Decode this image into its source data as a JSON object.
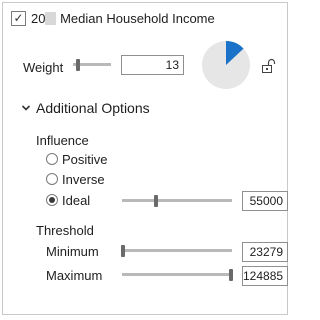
{
  "layer": {
    "checked": true,
    "title_prefix": "20",
    "title_suffix": "Median Household Income"
  },
  "weight": {
    "label": "Weight",
    "value": "13",
    "slider_fraction": 0.13,
    "pie_fraction": 0.13,
    "colors": {
      "pie_slice": "#1a73c8",
      "pie_base": "#e6e6e6"
    }
  },
  "additional_options": {
    "label": "Additional Options",
    "influence": {
      "label": "Influence",
      "options": [
        {
          "label": "Positive",
          "selected": false
        },
        {
          "label": "Inverse",
          "selected": false
        },
        {
          "label": "Ideal",
          "selected": true
        }
      ],
      "ideal_value": "55000",
      "ideal_slider_fraction": 0.31
    },
    "threshold": {
      "label": "Threshold",
      "minimum_label": "Minimum",
      "minimum_value": "23279",
      "minimum_slider_fraction": 0.01,
      "maximum_label": "Maximum",
      "maximum_value": "124885",
      "maximum_slider_fraction": 0.99
    }
  },
  "icons": {
    "lock": "unlock-icon",
    "chevron": "chevron-down-icon",
    "check": "checkmark-icon"
  }
}
